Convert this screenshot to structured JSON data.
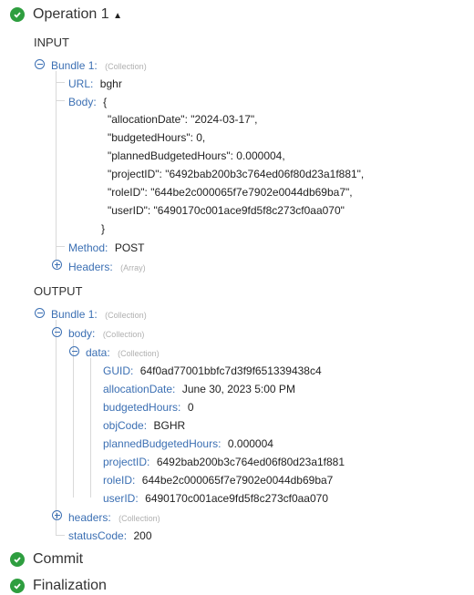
{
  "stages": {
    "operation": {
      "title": "Operation 1",
      "caret": "▲"
    },
    "commit": {
      "title": "Commit"
    },
    "finalization": {
      "title": "Finalization"
    }
  },
  "input": {
    "section_label": "INPUT",
    "bundle_label": "Bundle 1:",
    "bundle_type": "(Collection)",
    "url_key": "URL:",
    "url_value": "bghr",
    "body_key": "Body:",
    "body_open": "{",
    "body_lines": [
      "\"allocationDate\": \"2024-03-17\",",
      "\"budgetedHours\": 0,",
      "\"plannedBudgetedHours\": 0.000004,",
      "\"projectID\": \"6492bab200b3c764ed06f80d23a1f881\",",
      "\"roleID\": \"644be2c000065f7e7902e0044db69ba7\",",
      "\"userID\": \"6490170c001ace9fd5f8c273cf0aa070\""
    ],
    "body_close": "}",
    "method_key": "Method:",
    "method_value": "POST",
    "headers_key": "Headers:",
    "headers_type": "(Array)"
  },
  "output": {
    "section_label": "OUTPUT",
    "bundle_label": "Bundle 1:",
    "bundle_type": "(Collection)",
    "body_key": "body:",
    "body_type": "(Collection)",
    "data_key": "data:",
    "data_type": "(Collection)",
    "fields": [
      {
        "key": "GUID:",
        "value": "64f0ad77001bbfc7d3f9f651339438c4"
      },
      {
        "key": "allocationDate:",
        "value": "June 30, 2023 5:00 PM"
      },
      {
        "key": "budgetedHours:",
        "value": "0"
      },
      {
        "key": "objCode:",
        "value": "BGHR"
      },
      {
        "key": "plannedBudgetedHours:",
        "value": "0.000004"
      },
      {
        "key": "projectID:",
        "value": "6492bab200b3c764ed06f80d23a1f881"
      },
      {
        "key": "roleID:",
        "value": "644be2c000065f7e7902e0044db69ba7"
      },
      {
        "key": "userID:",
        "value": "6490170c001ace9fd5f8c273cf0aa070"
      }
    ],
    "headers_key": "headers:",
    "headers_type": "(Collection)",
    "status_key": "statusCode:",
    "status_value": "200"
  },
  "colors": {
    "check": "#2e9e3f",
    "key": "#3b6fb3",
    "type_hint": "#b0b0b0"
  }
}
